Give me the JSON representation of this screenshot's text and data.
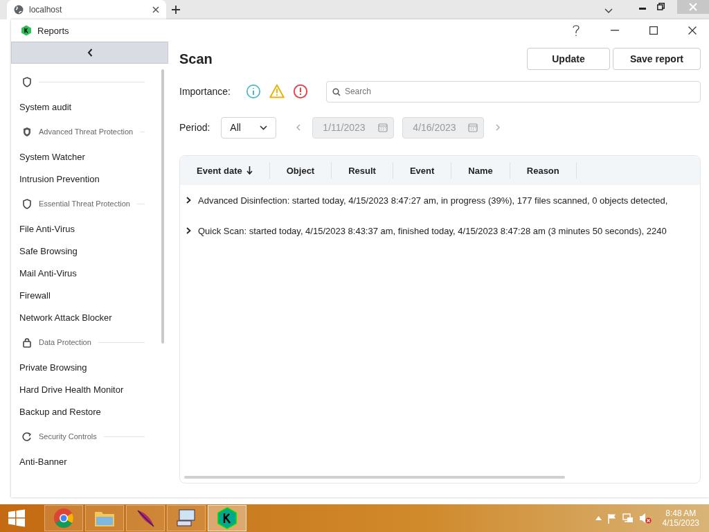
{
  "browser": {
    "tab": {
      "title": "localhost"
    }
  },
  "window": {
    "title": "Reports"
  },
  "sidebar": {
    "sections": [
      {
        "kind": "shield",
        "items": [
          {
            "label": "System audit",
            "selected": false
          }
        ]
      },
      {
        "kind": "shield-advanced",
        "label": "Advanced Threat Protection",
        "items": [
          {
            "label": "System Watcher",
            "selected": false
          },
          {
            "label": "Intrusion Prevention",
            "selected": false
          }
        ]
      },
      {
        "kind": "shield",
        "label": "Essential Threat Protection",
        "items": [
          {
            "label": "File Anti-Virus",
            "selected": false
          },
          {
            "label": "Safe Browsing",
            "selected": false
          },
          {
            "label": "Mail Anti-Virus",
            "selected": false
          },
          {
            "label": "Firewall",
            "selected": false
          },
          {
            "label": "Network Attack Blocker",
            "selected": false
          }
        ]
      },
      {
        "kind": "lock",
        "label": "Data Protection",
        "items": [
          {
            "label": "Private Browsing",
            "selected": false
          },
          {
            "label": "Hard Drive Health Monitor",
            "selected": false
          },
          {
            "label": "Backup and Restore",
            "selected": false
          }
        ]
      },
      {
        "kind": "shield-refresh",
        "label": "Security Controls",
        "items": [
          {
            "label": "Anti-Banner",
            "selected": false
          }
        ]
      }
    ]
  },
  "page": {
    "title": "Scan",
    "buttons": [
      "Update",
      "Save report"
    ]
  },
  "filters": {
    "importance_label": "Importance:",
    "importance": [
      {
        "kind": "info",
        "color": "#3fb8c9"
      },
      {
        "kind": "warning",
        "color": "#e8b400"
      },
      {
        "kind": "critical",
        "color": "#e0474c"
      }
    ],
    "search": {
      "placeholder": "Search"
    },
    "period_label": "Period:",
    "period": "All",
    "date_from": "1/11/2023",
    "date_to": "4/16/2023"
  },
  "table": {
    "columns": [
      {
        "label": "Event date",
        "sorted": true
      },
      {
        "label": "Object",
        "sorted": false
      },
      {
        "label": "Result",
        "sorted": false
      },
      {
        "label": "Event",
        "sorted": false
      },
      {
        "label": "Name",
        "sorted": false
      },
      {
        "label": "Reason",
        "sorted": false
      }
    ],
    "rows": [
      {
        "text": "Advanced Disinfection: started today, 4/15/2023 8:47:27 am, in progress (39%), 177 files scanned, 0 objects detected,",
        "expanded": false
      },
      {
        "text": "Quick Scan: started today, 4/15/2023 8:43:37 am, finished today, 4/15/2023 8:47:28 am (3 minutes 50 seconds), 2240",
        "expanded": false
      }
    ]
  },
  "taskbar": {
    "apps": [
      {
        "kind": "chrome",
        "active": false
      },
      {
        "kind": "explorer",
        "active": false
      },
      {
        "kind": "feather",
        "active": false
      },
      {
        "kind": "computer",
        "active": false
      },
      {
        "kind": "kaspersky",
        "active": true
      }
    ],
    "time": "8:48 AM",
    "date": "4/15/2023"
  }
}
